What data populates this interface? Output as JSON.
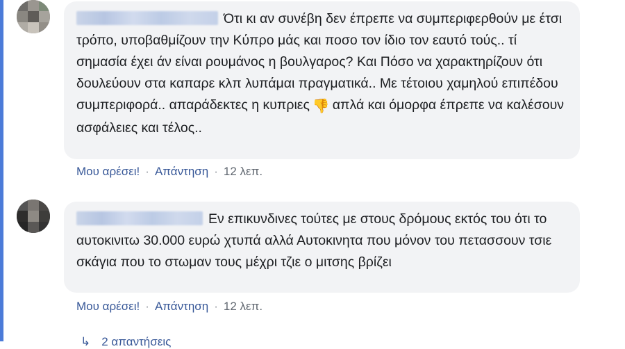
{
  "comments": [
    {
      "author": "",
      "text_parts": [
        "Ότι κι αν συνέβη δεν έπρεπε να συμπεριφερθούν με έτσι τρόπο, υποβαθμίζουν την Κύπρο μάς και ποσο τον ίδιο τον εαυτό τούς.. τί σημασία έχει άν είναι ρουμάνος η βουλγαρος? Και Πόσο να χαρακτηρίζουν ότι δουλεύουν στα καπαρε κλπ λυπάμαι πραγματικά.. Με τέτοιου χαμηλού επιπέδου συμπεριφορά.. απαράδεκτες η κυπριες",
        "απλά και όμορφα έπρεπε να καλέσουν ασφάλειες και τέλος.."
      ],
      "emoji": "👎",
      "like_label": "Μου αρέσει!",
      "reply_label": "Απάντηση",
      "time": "12 λεπ."
    },
    {
      "author": "",
      "text_parts": [
        "Εν επικυνδινες τούτες με στους δρόμους εκτός του ότι το αυτοκινιτω 30.000 ευρώ χτυπά αλλά Αυτοκινητα που μόνον του πετασσουν τσιε σκάγια που το στωμαν τους μέχρι τζιε ο μιτσης βρίζει"
      ],
      "like_label": "Μου αρέσει!",
      "reply_label": "Απάντηση",
      "time": "12 λεπ."
    }
  ],
  "replies_label": "2 απαντήσεις",
  "colors": {
    "link": "#385898",
    "bubble": "#f2f3f5",
    "thread": "#4b7bd8"
  }
}
